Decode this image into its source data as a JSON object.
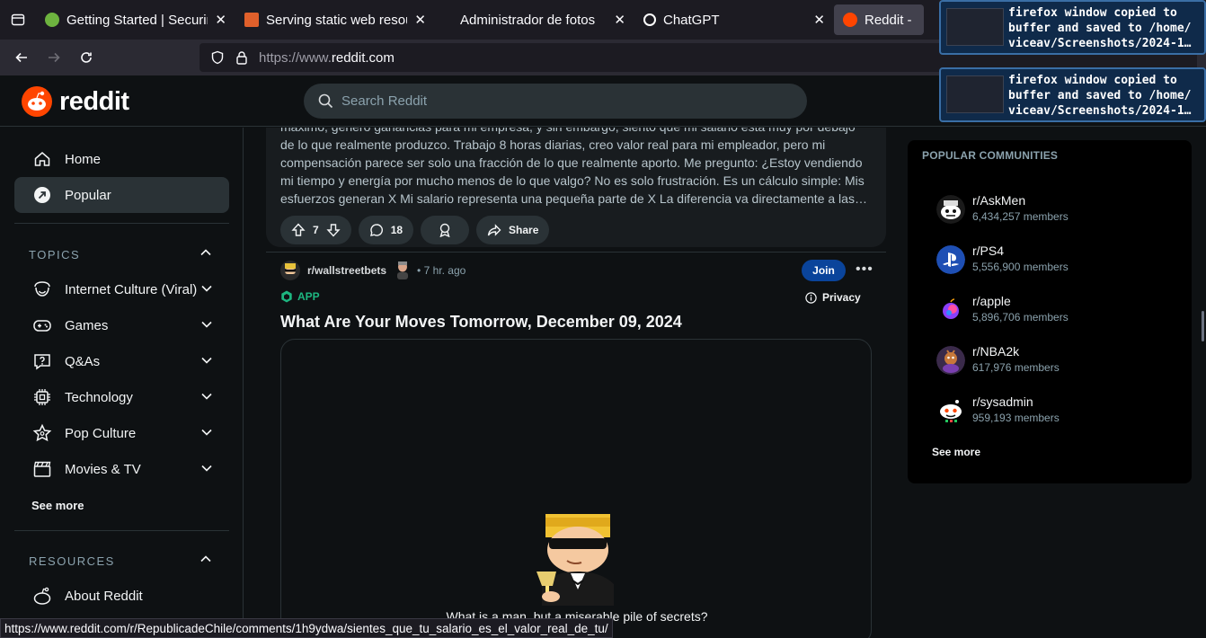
{
  "browser": {
    "tabs": [
      {
        "title": "Getting Started | Securing",
        "favicon_color": "#6db33f"
      },
      {
        "title": "Serving static web resour",
        "favicon_color": "#e0602b"
      },
      {
        "title": "Administrador de fotos",
        "favicon_color": ""
      },
      {
        "title": "ChatGPT",
        "favicon_color": "#ffffff"
      },
      {
        "title": "Reddit - Di",
        "favicon_color": "#ff4500"
      }
    ],
    "url_prefix": "https://www.",
    "url_host": "reddit.com",
    "status_url": "https://www.reddit.com/r/RepublicadeChile/comments/1h9ydwa/sientes_que_tu_salario_es_el_valor_real_de_tu/"
  },
  "header": {
    "logo_text": "reddit",
    "search_placeholder": "Search Reddit"
  },
  "sidebar": {
    "home": "Home",
    "popular": "Popular",
    "topics_title": "TOPICS",
    "topics": [
      {
        "label": "Internet Culture (Viral)",
        "icon": "smile-icon"
      },
      {
        "label": "Games",
        "icon": "gamepad-icon"
      },
      {
        "label": "Q&As",
        "icon": "question-icon"
      },
      {
        "label": "Technology",
        "icon": "chip-icon"
      },
      {
        "label": "Pop Culture",
        "icon": "star-icon"
      },
      {
        "label": "Movies & TV",
        "icon": "clapper-icon"
      }
    ],
    "see_more": "See more",
    "resources_title": "RESOURCES",
    "about": "About Reddit"
  },
  "post1": {
    "body_lines": [
      "máximo, genero ganancias para mi empresa, y sin embargo, siento que mi salario está muy por debajo",
      "de lo que realmente produzco. Trabajo 8 horas diarias, creo valor real para mi empleador, pero mi",
      "compensación parece ser solo una fracción de lo que realmente aporto. Me pregunto: ¿Estoy vendiendo",
      "mi tiempo y energía por mucho menos de lo que valgo? No es solo frustración. Es un cálculo simple: Mis",
      "esfuerzos generan X Mi salario representa una pequeña parte de X La diferencia va directamente a las…"
    ],
    "votes": "7",
    "comments": "18",
    "share": "Share"
  },
  "post2": {
    "subreddit": "r/wallstreetbets",
    "time": "• 7 hr. ago",
    "join": "Join",
    "flair": "APP",
    "privacy": "Privacy",
    "title": "What Are Your Moves Tomorrow, December 09, 2024",
    "meme_caption": "What is a man, but a miserable pile of secrets?"
  },
  "right_panel": {
    "title": "POPULAR COMMUNITIES",
    "communities": [
      {
        "name": "r/AskMen",
        "members": "6,434,257 members",
        "color": "#ffffff"
      },
      {
        "name": "r/PS4",
        "members": "5,556,900 members",
        "color": "#1e4fb4"
      },
      {
        "name": "r/apple",
        "members": "5,896,706 members",
        "color": "#8a3ffc"
      },
      {
        "name": "r/NBA2k",
        "members": "617,976 members",
        "color": "#3a2a4a"
      },
      {
        "name": "r/sysadmin",
        "members": "959,193 members",
        "color": "#ffffff"
      }
    ],
    "see_more": "See more"
  },
  "notifications": [
    {
      "lines": [
        "firefox window copied to",
        "buffer and saved to /home/",
        "viceav/Screenshots/2024-1…"
      ]
    },
    {
      "lines": [
        "firefox window copied to",
        "buffer and saved to /home/",
        "viceav/Screenshots/2024-1…"
      ]
    }
  ]
}
